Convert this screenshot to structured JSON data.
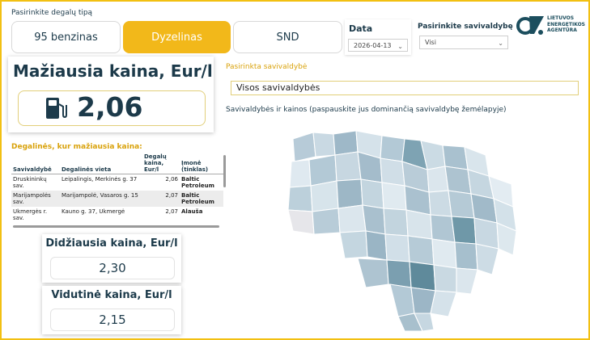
{
  "filters": {
    "fuel_type_label": "Pasirinkite degalų tipą",
    "fuel_types": [
      "95 benzinas",
      "Dyzelinas",
      "SND"
    ],
    "selected_fuel": "Dyzelinas",
    "date_label": "Data",
    "date_value": "2026-04-13",
    "municipality_label": "Pasirinkite savivaldybę",
    "municipality_value": "Visi"
  },
  "logo": {
    "line1": "LIETUVOS",
    "line2": "ENERGETIKOS",
    "line3": "AGENTŪRA",
    "color": "#1c4e5e"
  },
  "min_price": {
    "title": "Mažiausia kaina, Eur/l",
    "value": "2,06"
  },
  "stations": {
    "title": "Degalinės, kur mažiausia kaina:",
    "columns": [
      "Savivaldybė",
      "Degalinės vieta",
      "Degalų kaina, Eur/l",
      "Įmonė (tinklas)"
    ],
    "rows": [
      [
        "Druskininkų sav.",
        "Leipalingis, Merkinės g. 37",
        "2,06",
        "Baltic Petroleum"
      ],
      [
        "Marijampolės sav.",
        "Marijampolė, Vasaros g. 15",
        "2,07",
        "Baltic Petroleum"
      ],
      [
        "Ukmergės r. sav.",
        "Kauno g. 37, Ukmergė",
        "2,07",
        "Alauša"
      ]
    ]
  },
  "max_price": {
    "title": "Didžiausia kaina, Eur/l",
    "value": "2,30"
  },
  "avg_price": {
    "title": "Vidutinė kaina, Eur/l",
    "value": "2,15"
  },
  "selected_municipality": {
    "label": "Pasirinkta savivaldybė",
    "value": "Visos savivaldybės"
  },
  "map": {
    "title": "Savivaldybės ir kainos (paspauskite jus dominančią savivaldybę žemėlapyje)"
  },
  "colors": {
    "accent": "#f2b81a",
    "title_text": "#1c3a4a",
    "map_light": "#dfe9f0",
    "map_mid": "#b3c9d6",
    "map_dark": "#6f98a8"
  }
}
